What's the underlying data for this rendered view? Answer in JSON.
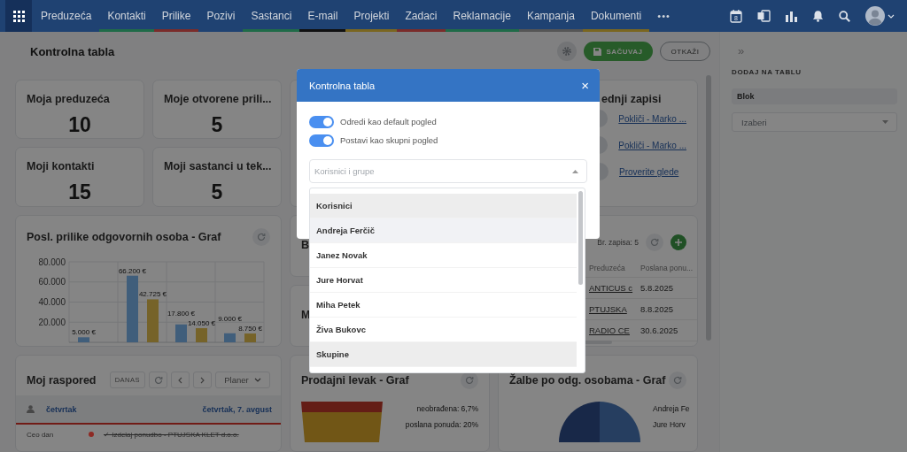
{
  "nav": {
    "items": [
      {
        "label": "Preduzeća"
      },
      {
        "label": "Kontakti",
        "color": "#1f6b48"
      },
      {
        "label": "Prilike",
        "color": "#7a2c2a"
      },
      {
        "label": "Pozivi"
      },
      {
        "label": "Sastanci",
        "color": "#1f6b48"
      },
      {
        "label": "E-mail",
        "color": "#111111"
      },
      {
        "label": "Projekti",
        "color": "#7a6620"
      },
      {
        "label": "Zadaci",
        "color": "#7a2c2a"
      },
      {
        "label": "Reklamacije",
        "color": "#1f6b48"
      },
      {
        "label": "Kampanja",
        "color": "#555555"
      },
      {
        "label": "Dokumenti",
        "color": "#7a6620"
      }
    ],
    "more": "•••",
    "calendar_day": "8"
  },
  "header": {
    "title": "Kontrolna tabla",
    "save_button": "SAČUVAJ",
    "cancel_button": "OTKAŽI"
  },
  "widgets": [
    {
      "kind": "stat",
      "title": "Moja preduzeća",
      "value": "10"
    },
    {
      "kind": "stat",
      "title": "Moje otvorene prili...",
      "value": "5"
    },
    {
      "kind": "blank"
    },
    {
      "kind": "records",
      "title": "ednji zapisi",
      "links": [
        "Pokliči - Marko ...",
        "Pokliči - Marko ...",
        "Proverite glede"
      ]
    },
    {
      "kind": "stat",
      "title": "Moji kontakti",
      "value": "15"
    },
    {
      "kind": "stat",
      "title": "Moji sastanci u tek...",
      "value": "5"
    },
    {
      "kind": "chart",
      "title": "Posl. prilike odgovornih osoba - Graf",
      "chart_data": {
        "type": "bar",
        "grid": true,
        "ylim": [
          0,
          80000
        ],
        "yticks": [
          {
            "value": 20000,
            "label": "20.000"
          },
          {
            "value": 40000,
            "label": "40.000"
          },
          {
            "value": 60000,
            "label": "60.000"
          },
          {
            "value": 80000,
            "label": "80.000"
          }
        ],
        "series": [
          {
            "color": "#7cb5ec",
            "values": [
              5000,
              66200,
              17800,
              9000
            ]
          },
          {
            "color": "#e2bf4f",
            "values": [
              null,
              42725,
              14050,
              8750
            ]
          }
        ],
        "value_labels": [
          [
            "5.000 €",
            "66.200 €",
            "17.800 €",
            "9.000 €"
          ],
          [
            null,
            "42.725 €",
            "14.050 €",
            "8.750 €"
          ]
        ]
      }
    },
    {
      "kind": "letter",
      "title": "B"
    },
    {
      "kind": "table",
      "count": "Br. zapisa: 5",
      "columns": [
        "Preduzeća",
        "Poslana ponu..."
      ],
      "rows": [
        [
          "ANTICUS c",
          "5.8.2025"
        ],
        [
          "PTUJSKA",
          "8.8.2025"
        ],
        [
          "RADIO CE",
          "30.6.2025"
        ]
      ]
    },
    {
      "kind": "letter",
      "title": "M"
    },
    {
      "kind": "schedule",
      "title": "Moj raspored",
      "today_button": "DANAS",
      "view": "Planer",
      "day": "četvrtak",
      "date": "četvrtak, 7. avgust",
      "events": [
        {
          "time": "Ceo dan",
          "color": "#8e2a24",
          "done": true,
          "title": "✓ Izdelaj ponudbo - PTUJSKA KLET d.o.o."
        }
      ]
    },
    {
      "kind": "funnel",
      "title": "Prodajni levak - Graf",
      "labels": [
        "neobrađena: 6,7%",
        "poslana ponuda: 20%"
      ]
    },
    {
      "kind": "pie",
      "title": "Žalbe po odg. osobama - Graf",
      "labels": [
        "Andreja Fe",
        "Jure Horv"
      ]
    }
  ],
  "sidebar": {
    "collapse": "»",
    "title": "DODAJ NA TABLU",
    "section": "Blok",
    "select": {
      "placeholder": "Izaberi"
    }
  },
  "modal": {
    "title": "Kontrolna tabla",
    "close": "×",
    "toggles": [
      {
        "label": "Odredi kao default pogled",
        "on": true
      },
      {
        "label": "Postavi kao skupni pogled",
        "on": true
      }
    ],
    "select": {
      "placeholder": "Korisnici i grupe"
    },
    "dropdown": {
      "items": [
        {
          "kind": "group",
          "label": "Korisnici"
        },
        {
          "kind": "option",
          "label": "Andreja Ferčič",
          "highlighted": true
        },
        {
          "kind": "option",
          "label": "Janez Novak",
          "highlighted": false
        },
        {
          "kind": "option",
          "label": "Jure Horvat",
          "highlighted": false
        },
        {
          "kind": "option",
          "label": "Miha Petek",
          "highlighted": false
        },
        {
          "kind": "option",
          "label": "Živa Bukovc",
          "highlighted": false
        },
        {
          "kind": "group",
          "label": "Skupine"
        }
      ]
    }
  }
}
